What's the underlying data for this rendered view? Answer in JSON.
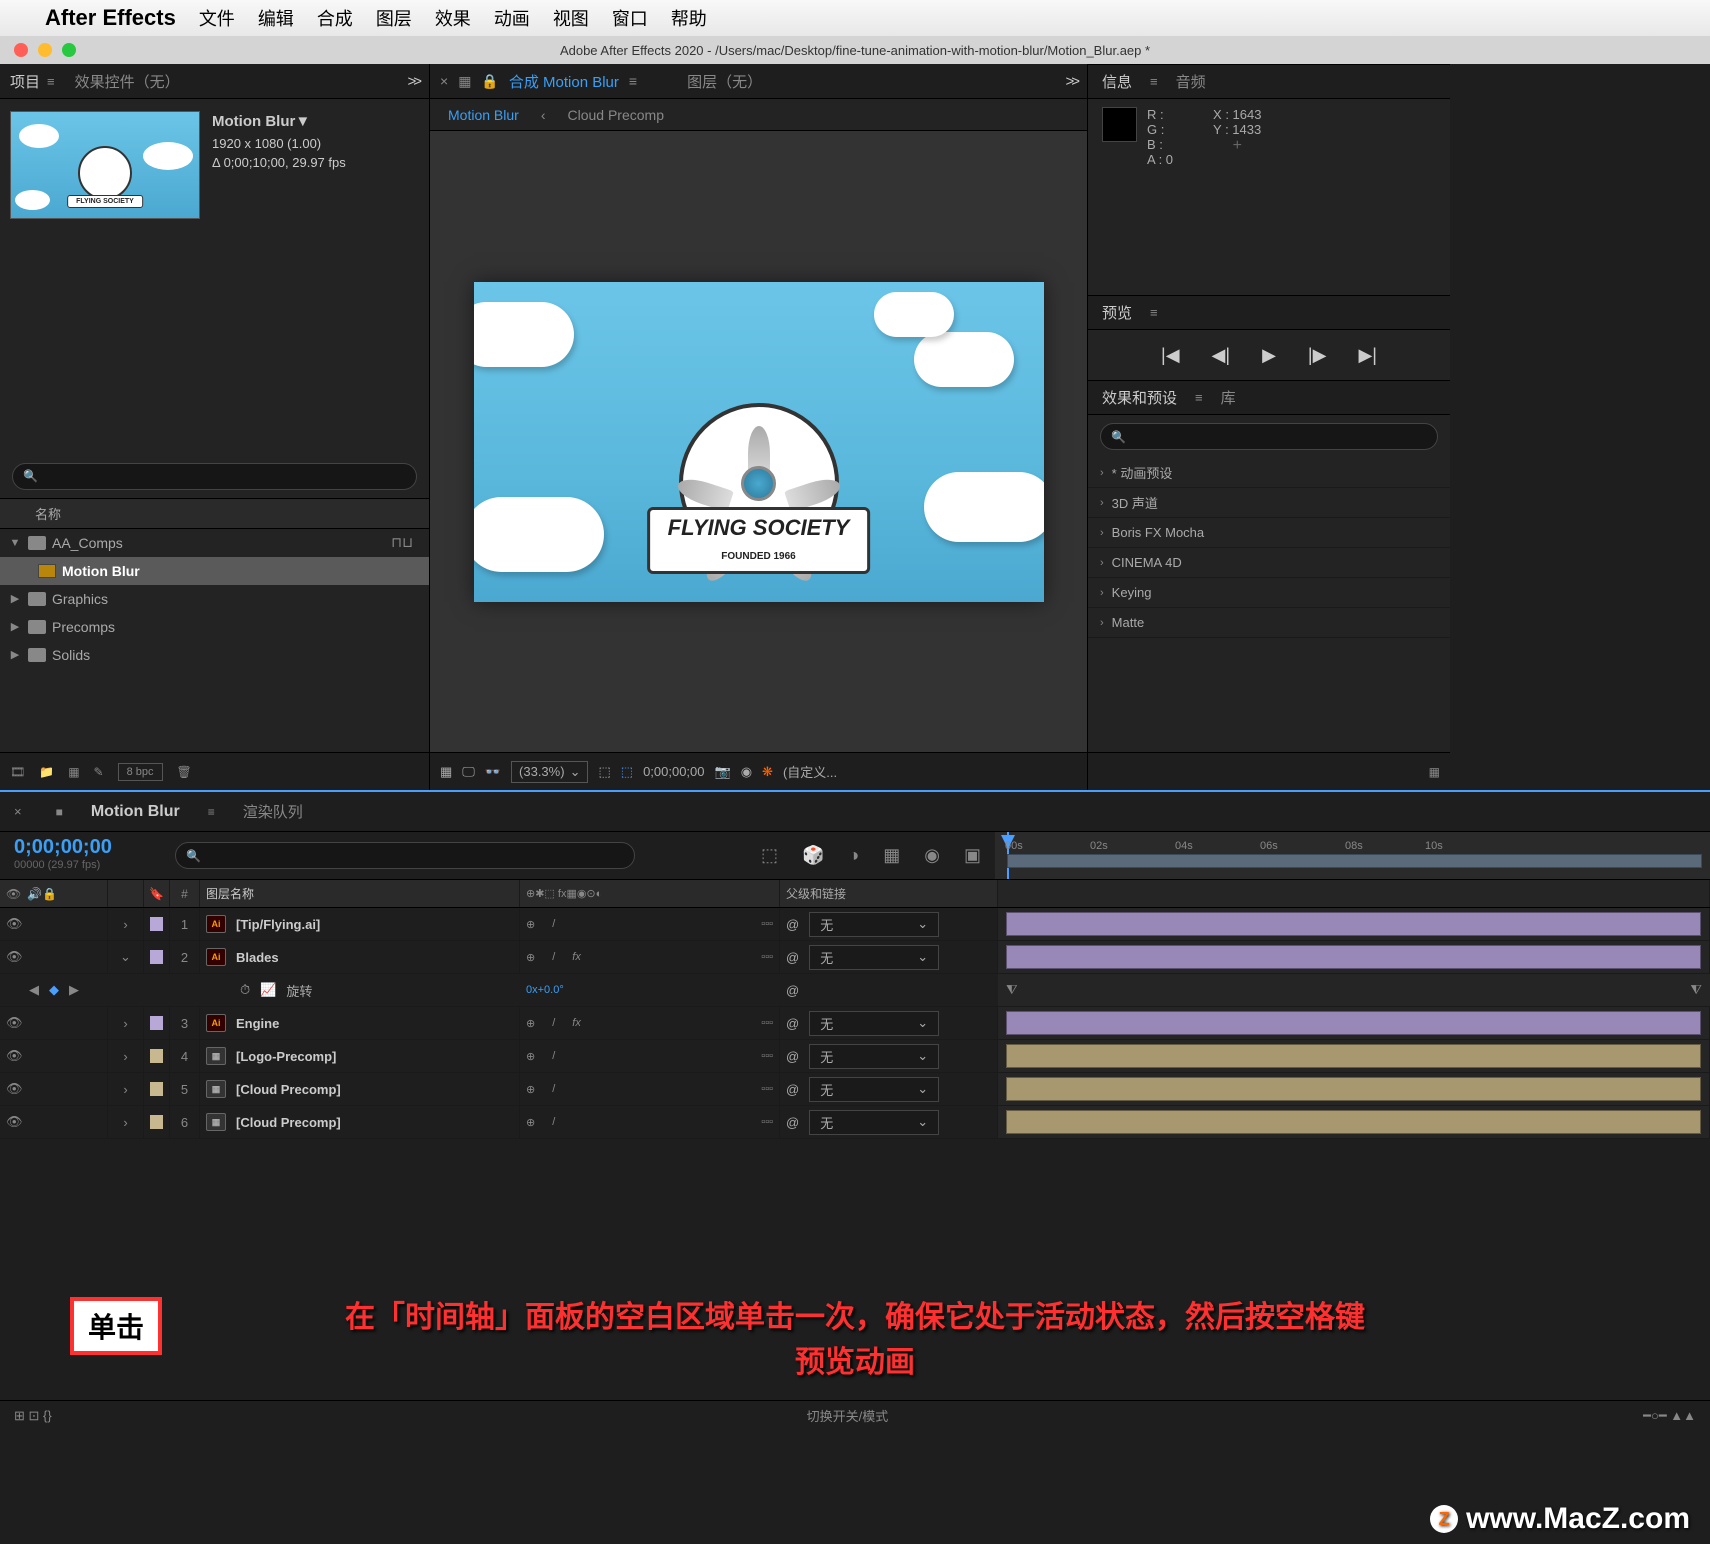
{
  "menubar": {
    "app": "After Effects",
    "items": [
      "文件",
      "编辑",
      "合成",
      "图层",
      "效果",
      "动画",
      "视图",
      "窗口",
      "帮助"
    ]
  },
  "titlebar": "Adobe After Effects 2020 - /Users/mac/Desktop/fine-tune-animation-with-motion-blur/Motion_Blur.aep *",
  "project": {
    "tab1": "项目",
    "tab2": "效果控件（无）",
    "name": "Motion Blur",
    "dims": "1920 x 1080 (1.00)",
    "dur": "Δ 0;00;10;00, 29.97 fps",
    "colhdr": "名称",
    "tree": [
      {
        "name": "AA_Comps",
        "type": "folder",
        "open": true,
        "sel": false
      },
      {
        "name": "Motion Blur",
        "type": "comp",
        "indent": 1,
        "sel": true
      },
      {
        "name": "Graphics",
        "type": "folder",
        "open": false
      },
      {
        "name": "Precomps",
        "type": "folder",
        "open": false
      },
      {
        "name": "Solids",
        "type": "folder",
        "open": false
      }
    ],
    "bpc": "8 bpc"
  },
  "composition": {
    "tab_comp": "合成 Motion Blur",
    "tab_layer": "图层（无）",
    "crumb_active": "Motion Blur",
    "crumb2": "Cloud Precomp",
    "logo_text": "FLYING SOCIETY",
    "logo_sub": "FOUNDED 1966",
    "zoom": "(33.3%)",
    "tc": "0;00;00;00",
    "custom": "(自定义..."
  },
  "info": {
    "tab1": "信息",
    "tab2": "音频",
    "r": "R :",
    "g": "G :",
    "b": "B :",
    "a": "A :  0",
    "x": "X :  1643",
    "y": "Y :  1433"
  },
  "preview": {
    "tab": "预览"
  },
  "effects": {
    "tab1": "效果和预设",
    "tab2": "库",
    "items": [
      "* 动画预设",
      "3D 声道",
      "Boris FX Mocha",
      "CINEMA 4D",
      "Keying",
      "Matte"
    ]
  },
  "timeline": {
    "tab_active": "Motion Blur",
    "tab2": "渲染队列",
    "tc": "0;00;00;00",
    "fps": "00000 (29.97 fps)",
    "ruler": [
      "00s",
      "02s",
      "04s",
      "06s",
      "08s",
      "10s"
    ],
    "hdr_name": "图层名称",
    "hdr_parent": "父级和链接",
    "layers": [
      {
        "num": "1",
        "name": "[Tip/Flying.ai]",
        "type": "ai",
        "color": "#b8a8d8",
        "parent": "无",
        "bar": "#9888b8",
        "fx": false
      },
      {
        "num": "2",
        "name": "Blades",
        "type": "ai",
        "color": "#b8a8d8",
        "parent": "无",
        "bar": "#9888b8",
        "fx": true,
        "open": true
      },
      {
        "num": "3",
        "name": "Engine",
        "type": "ai",
        "color": "#b8a8d8",
        "parent": "无",
        "bar": "#9888b8",
        "fx": true
      },
      {
        "num": "4",
        "name": "[Logo-Precomp]",
        "type": "pc",
        "color": "#c8b890",
        "parent": "无",
        "bar": "#a89870"
      },
      {
        "num": "5",
        "name": "[Cloud Precomp]",
        "type": "pc",
        "color": "#c8b890",
        "parent": "无",
        "bar": "#a89870"
      },
      {
        "num": "6",
        "name": "[Cloud Precomp]",
        "type": "pc",
        "color": "#c8b890",
        "parent": "无",
        "bar": "#a89870"
      }
    ],
    "prop_name": "旋转",
    "prop_val": "0x+0.0°",
    "footer": "切换开关/模式"
  },
  "annotation": {
    "line1": "在「时间轴」面板的空白区域单击一次，确保它处于活动状态，然后按空格键",
    "line2": "预览动画",
    "click": "单击"
  },
  "watermark": "www.MacZ.com"
}
